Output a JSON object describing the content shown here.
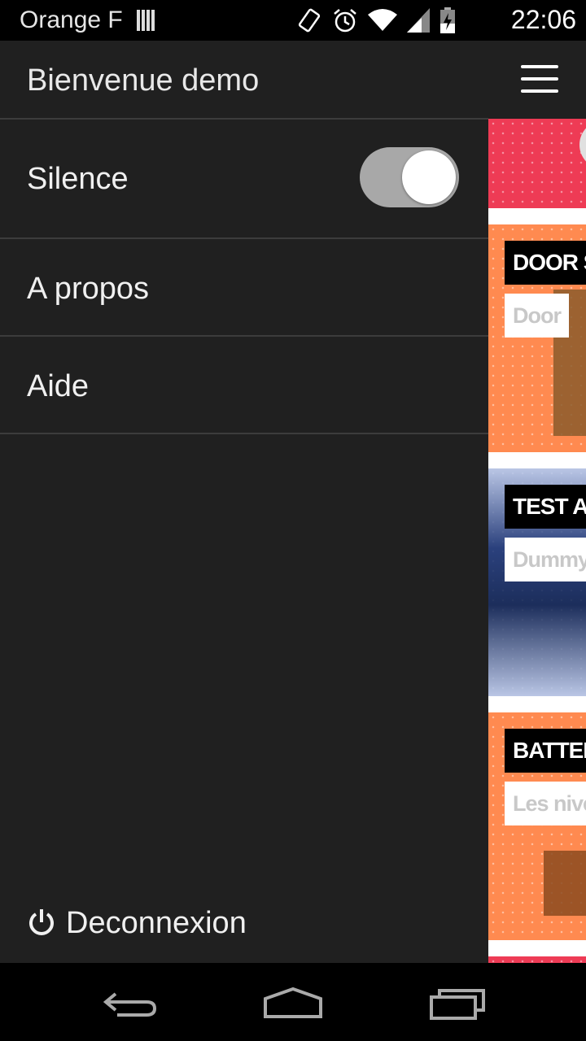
{
  "status_bar": {
    "carrier": "Orange F",
    "time": "22:06",
    "icons": [
      "signal-bars-icon",
      "vibrate-icon",
      "alarm-icon",
      "wifi-icon",
      "cell-signal-icon",
      "battery-charging-icon"
    ]
  },
  "drawer": {
    "title": "Bienvenue demo",
    "items": [
      {
        "label": "Silence",
        "type": "toggle",
        "state": "on"
      },
      {
        "label": "A propos"
      },
      {
        "label": "Aide"
      }
    ],
    "logout": {
      "label": "Deconnexion",
      "icon": "power-icon"
    }
  },
  "behind": {
    "menu_icon": "hamburger-menu-icon",
    "cards": [
      {
        "title": "DOOR S",
        "subtitle": "Door",
        "color": "#ff8a50"
      },
      {
        "title": "TEST AP",
        "subtitle": "Dummy",
        "color": "#2f4f94"
      },
      {
        "title": "BATTERY",
        "subtitle": "Les nive",
        "color": "#ff8a50"
      }
    ],
    "accent_color": "#ee3b55"
  },
  "nav_bar": {
    "buttons": [
      "back-icon",
      "home-icon",
      "recents-icon"
    ]
  },
  "colors": {
    "drawer_bg": "#202020",
    "divider": "#3c3c3c",
    "toggle_track": "#a8a8a8"
  }
}
